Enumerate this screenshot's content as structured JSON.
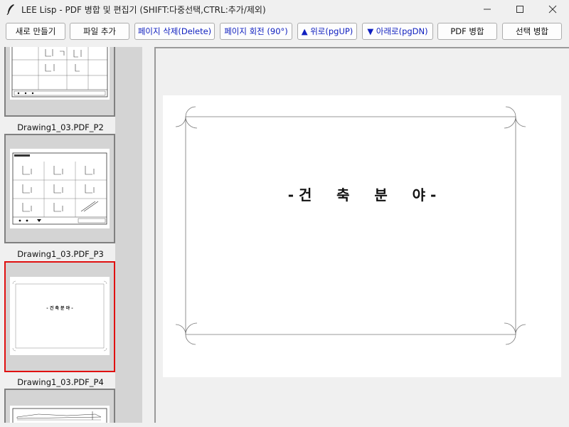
{
  "window": {
    "title": "LEE Lisp - PDF 병합 및 편집기 (SHIFT:다중선택,CTRL:추가/제외)",
    "icon": "feather-icon",
    "controls": [
      "minimize-icon",
      "maximize-icon",
      "close-icon"
    ]
  },
  "toolbar": {
    "new_label": "새로 만들기",
    "add_file_label": "파일 추가",
    "delete_page_label": "페이지 삭제(Delete)",
    "rotate_page_label": "페이지 회전 (90°)",
    "move_up_label": "▲ 위로(pgUP)",
    "move_down_label": "▼ 아래로(pgDN)",
    "merge_pdf_label": "PDF 병합",
    "merge_selected_label": "선택 병합"
  },
  "thumbnails": [
    {
      "label": "Drawing1_03.PDF_P2",
      "kind": "drawing-grid",
      "selected": false
    },
    {
      "label": "Drawing1_03.PDF_P3",
      "kind": "drawing-grid",
      "selected": false
    },
    {
      "label": "Drawing1_03.PDF_P4",
      "kind": "title-page",
      "title": "- 건   축   분   야 -",
      "selected": true
    },
    {
      "label": "",
      "kind": "drawing-section",
      "selected": false
    }
  ],
  "preview": {
    "page_title": "- 건     축     분     야 -"
  },
  "colors": {
    "selection": "#e01010",
    "toolbar_blue_text": "#1020c0",
    "panel_bg": "#f0f0f0"
  }
}
